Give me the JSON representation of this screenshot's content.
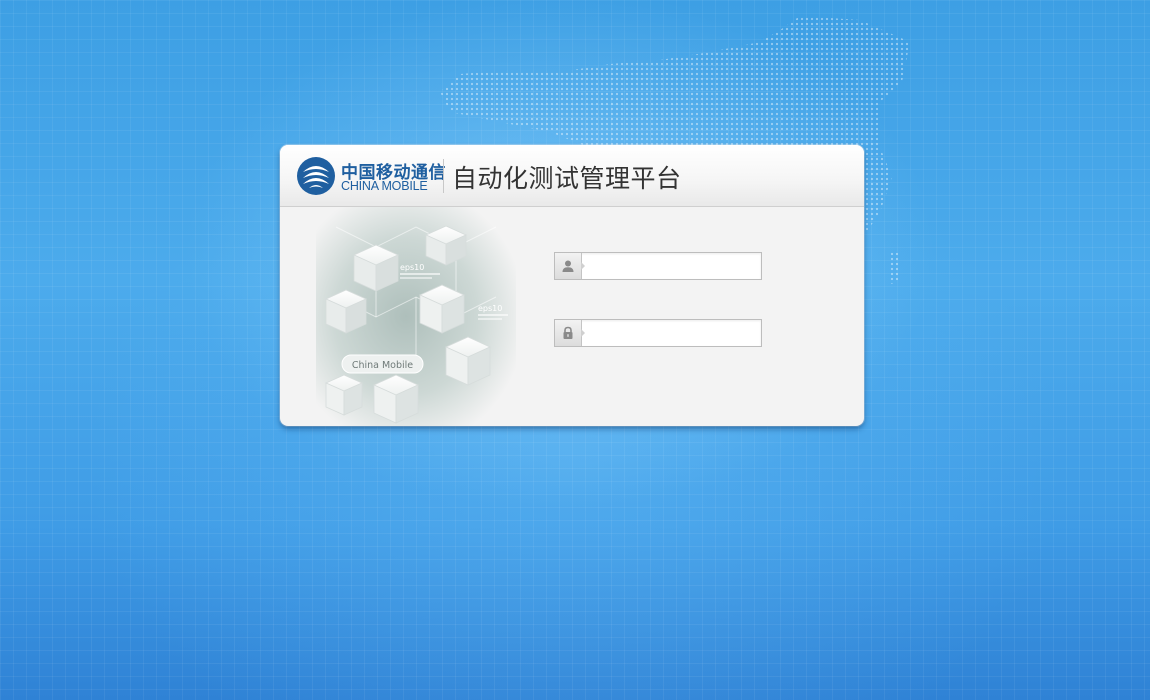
{
  "header": {
    "brand_cn": "中国移动通信",
    "brand_en": "CHINA MOBILE",
    "platform_title": "自动化测试管理平台"
  },
  "illustration": {
    "badge_text": "China Mobile",
    "eps_label_1": "eps10",
    "eps_label_2": "eps10"
  },
  "login_form": {
    "username": {
      "icon": "user-icon",
      "value": "",
      "placeholder": ""
    },
    "password": {
      "icon": "lock-icon",
      "value": "",
      "placeholder": ""
    }
  },
  "colors": {
    "brand_blue": "#1f5fa0",
    "background_blue": "#4cabec",
    "card_background": "#f3f3f3",
    "title_text": "#333333"
  }
}
